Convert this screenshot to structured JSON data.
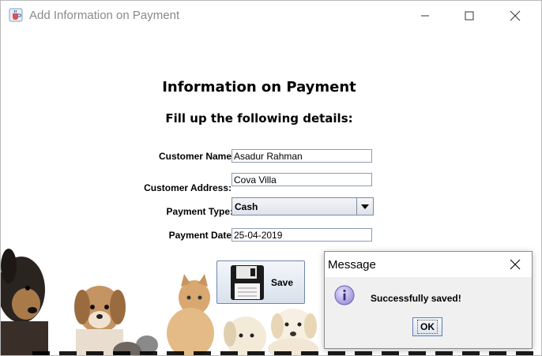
{
  "window": {
    "title": "Add Information on Payment"
  },
  "form": {
    "heading": "Information on Payment",
    "subheading": "Fill up the following details:",
    "customer_name_label": "Customer Name",
    "customer_name_value": "Asadur Rahman",
    "customer_address_label": "Customer Address:",
    "customer_address_value": "Cova Villa",
    "payment_type_label": "Payment Type:",
    "payment_type_value": "Cash",
    "payment_date_label": "Payment Date",
    "payment_date_value": "25-04-2019",
    "save_label": "Save"
  },
  "dialog": {
    "title": "Message",
    "message": "Successfully saved!",
    "ok_label": "OK"
  },
  "icons": {
    "app": "java-coffee-cup-icon",
    "minimize": "minimize-icon",
    "maximize": "maximize-icon",
    "close": "close-icon",
    "combo_arrow": "chevron-down-icon",
    "save": "floppy-disk-icon",
    "info": "info-icon"
  },
  "colors": {
    "field_border": "#8a9db5",
    "button_border": "#6f86a8",
    "info_icon": "#7b6fc4",
    "title_text": "#8a8a8a"
  }
}
